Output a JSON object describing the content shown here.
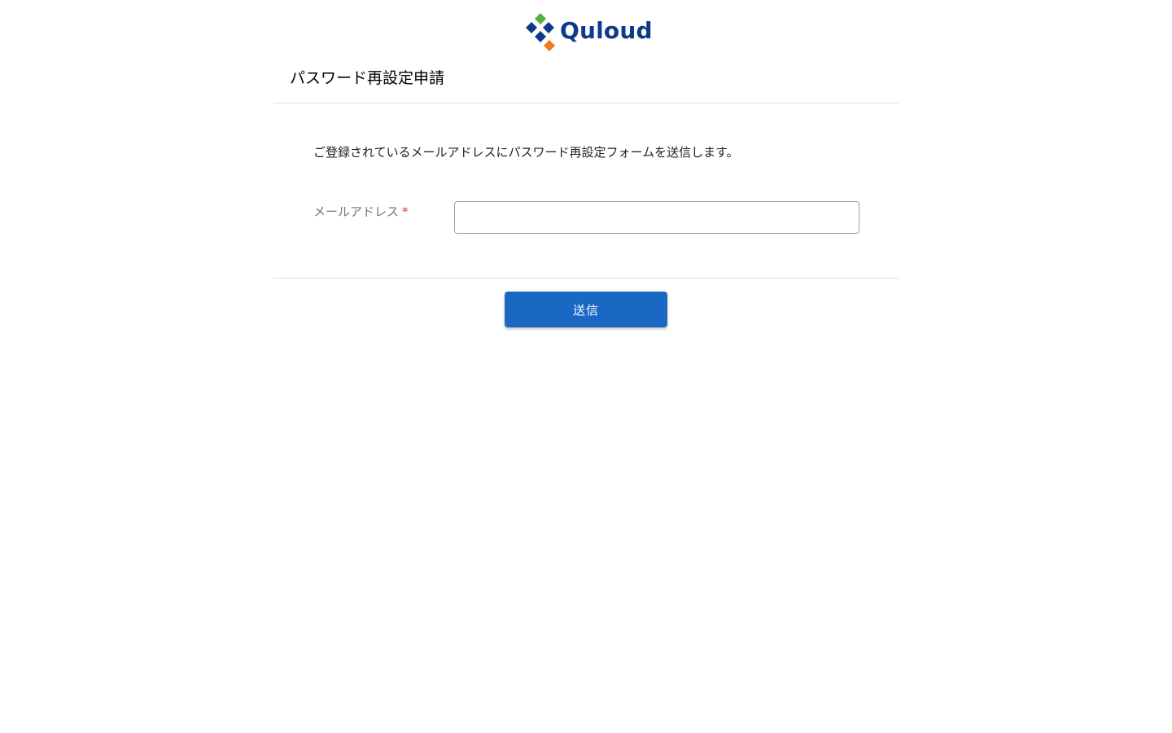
{
  "brand": {
    "name": "Quloud",
    "colors": {
      "navy": "#0d3a8c",
      "green": "#55b045",
      "orange": "#ee7d1a"
    }
  },
  "form": {
    "title": "パスワード再設定申請",
    "description": "ご登録されているメールアドレスにパスワード再設定フォームを送信します。",
    "email_label": "メールアドレス",
    "required_mark": "*",
    "email_value": "",
    "email_placeholder": "",
    "submit_label": "送信"
  },
  "colors": {
    "primary_button": "#1a68c4",
    "required": "#e53935"
  }
}
